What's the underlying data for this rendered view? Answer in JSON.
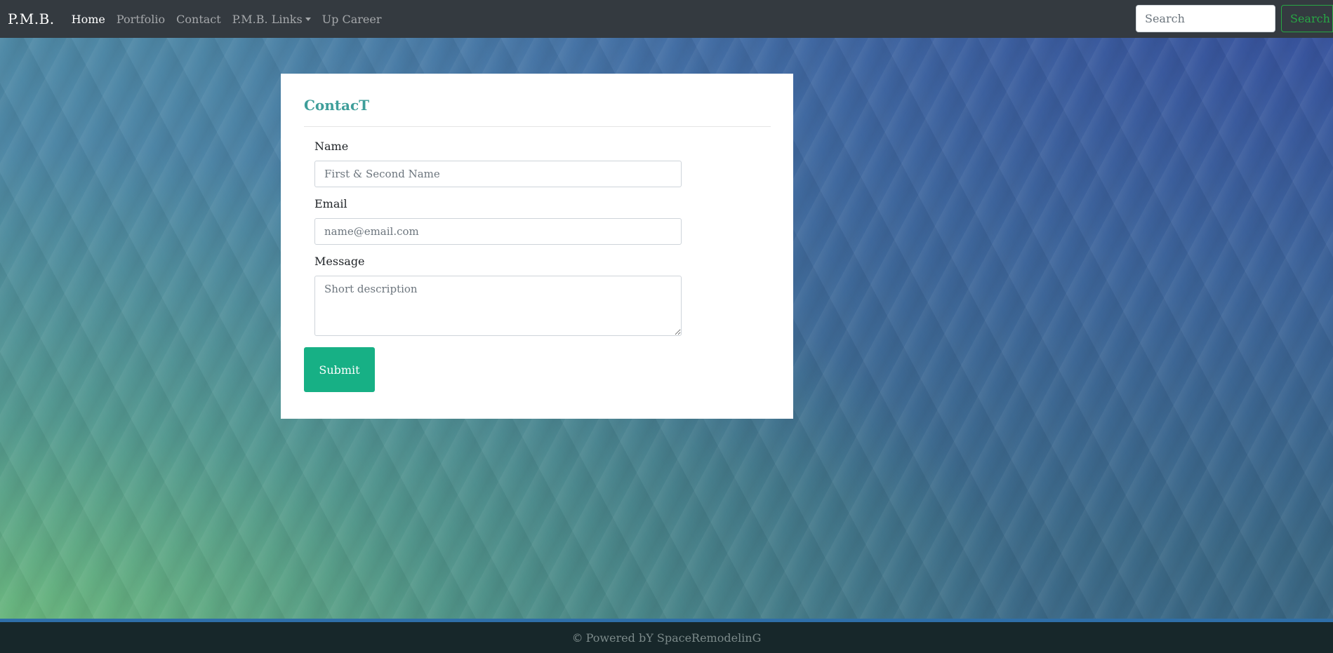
{
  "navbar": {
    "brand": "P.M.B.",
    "links": [
      {
        "label": "Home",
        "active": true
      },
      {
        "label": "Portfolio"
      },
      {
        "label": "Contact"
      },
      {
        "label": "P.M.B. Links",
        "dropdown": true
      },
      {
        "label": "Up Career"
      }
    ],
    "search": {
      "placeholder": "Search",
      "button_label": "Search"
    }
  },
  "contact_form": {
    "title": "ContacT",
    "name": {
      "label": "Name",
      "placeholder": "First & Second Name"
    },
    "email": {
      "label": "Email",
      "placeholder": "name@email.com"
    },
    "message": {
      "label": "Message",
      "placeholder": "Short description"
    },
    "submit_label": "Submit"
  },
  "footer": {
    "icon": "copyright-icon",
    "copyright_symbol": "©",
    "text": "Powered bY SpaceRemodelinG"
  },
  "colors": {
    "navbar_bg": "#343a40",
    "accent_green": "#17b085",
    "title_teal": "#3e9e9a",
    "search_outline": "#28a745",
    "footer_bg": "#17272a",
    "footer_line": "#2f6fa8"
  }
}
